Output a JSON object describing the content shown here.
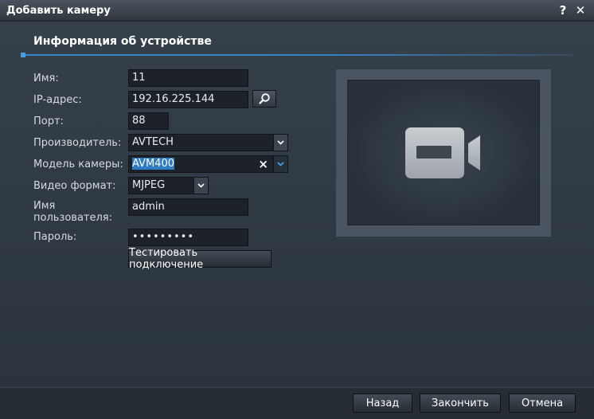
{
  "window": {
    "title": "Добавить камеру",
    "help_label": "?",
    "close_label": "✕"
  },
  "section": {
    "title": "Информация об устройстве"
  },
  "form": {
    "name": {
      "label": "Имя:",
      "value": "11"
    },
    "ip": {
      "label": "IP-адрес:",
      "value": "192.16.225.144"
    },
    "port": {
      "label": "Порт:",
      "value": "88"
    },
    "vendor": {
      "label": "Производитель:",
      "value": "AVTECH"
    },
    "model": {
      "label": "Модель камеры:",
      "value": "AVM400"
    },
    "video_format": {
      "label": "Видео формат:",
      "value": "MJPEG"
    },
    "username": {
      "label_line1": "Имя",
      "label_line2": "пользователя:",
      "value": "admin"
    },
    "password": {
      "label": "Пароль:",
      "value": "•••••••••"
    },
    "test_button": "Тестировать подключение"
  },
  "footer": {
    "back": "Назад",
    "finish": "Закончить",
    "cancel": "Отмена"
  },
  "icons": {
    "search": "search-icon",
    "dropdown": "chevron-down-icon",
    "clear": "clear-icon",
    "camera": "video-camera-icon"
  },
  "colors": {
    "accent": "#3a7fbd",
    "selection": "#2f7bc4"
  }
}
